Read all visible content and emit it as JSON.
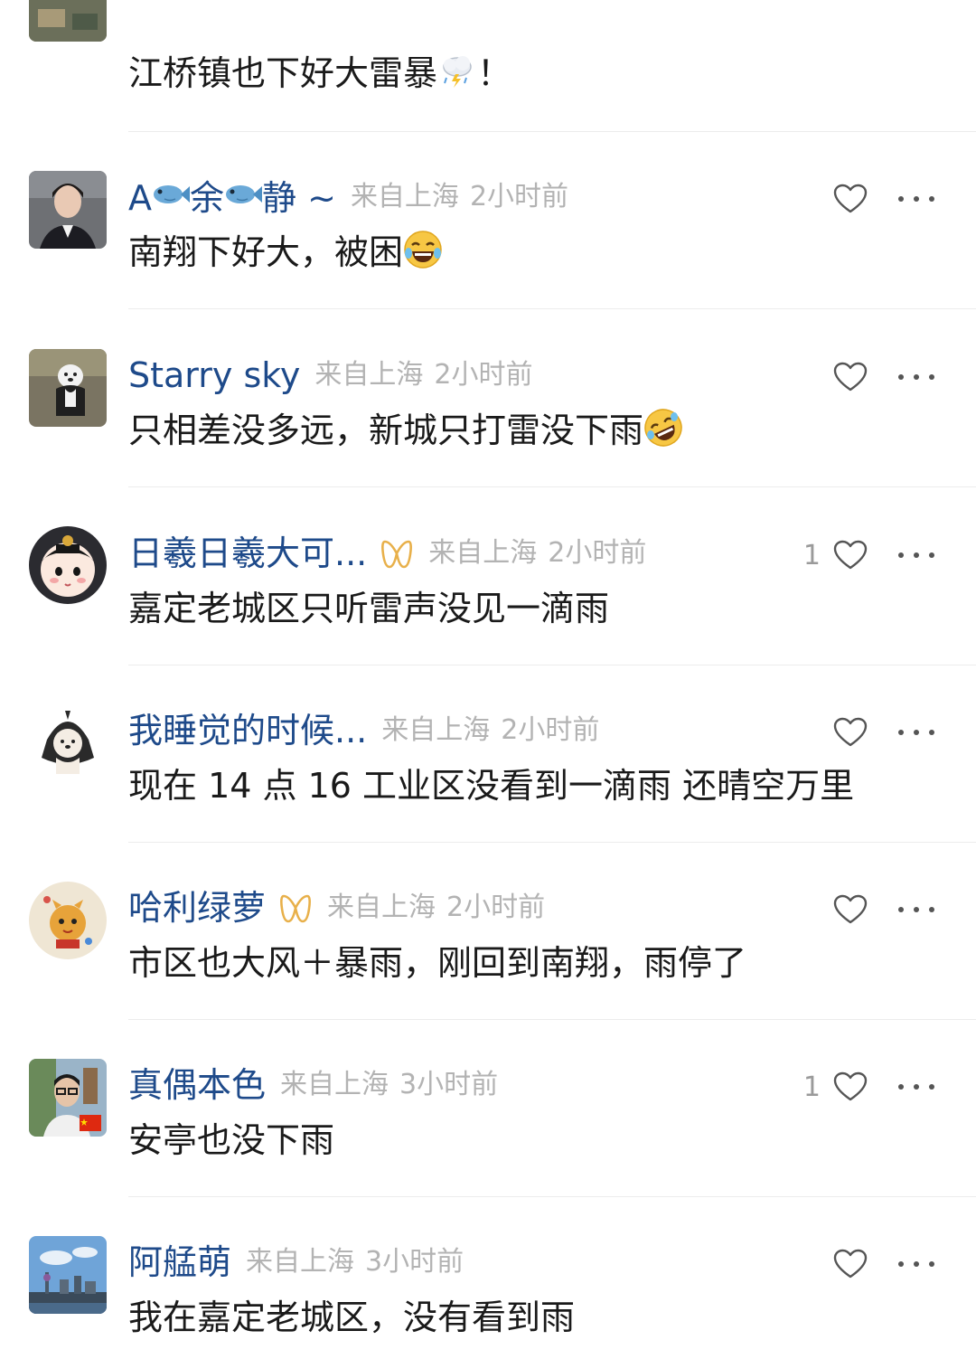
{
  "comments": [
    {
      "username": "",
      "text": "江桥镇也下好大雷暴",
      "text_suffix": "！",
      "emoji": "thunderstorm-emoji"
    },
    {
      "username_parts": [
        "A",
        "余",
        "静 ~"
      ],
      "location": "来自上海",
      "time": "2小时前",
      "text": "南翔下好大，被困",
      "emoji": "laughing-crying-emoji",
      "likes": ""
    },
    {
      "username": "Starry sky",
      "location": "来自上海",
      "time": "2小时前",
      "text": "只相差没多远，新城只打雷没下雨",
      "emoji": "rolling-laughing-emoji",
      "likes": ""
    },
    {
      "username": "日羲日羲大可...",
      "badge": "fan-badge-icon",
      "location": "来自上海",
      "time": "2小时前",
      "text": "嘉定老城区只听雷声没见一滴雨",
      "likes": "1"
    },
    {
      "username": "我睡觉的时候...",
      "location": "来自上海",
      "time": "2小时前",
      "text": "现在 14 点 16 工业区没看到一滴雨 还晴空万里",
      "likes": ""
    },
    {
      "username": "哈利绿萝",
      "badge": "fan-badge-icon",
      "location": "来自上海",
      "time": "2小时前",
      "text": "市区也大风＋暴雨，刚回到南翔，雨停了",
      "likes": ""
    },
    {
      "username": "真偶本色",
      "location": "来自上海",
      "time": "3小时前",
      "text": "安亭也没下雨",
      "likes": "1"
    },
    {
      "username": "阿艋萌",
      "location": "来自上海",
      "time": "3小时前",
      "text": "我在嘉定老城区，没有看到雨",
      "likes": ""
    }
  ],
  "colors": {
    "username": "#1e4a8a",
    "meta": "#b3b3b3",
    "text": "#1a1a1a",
    "divider": "#ececec",
    "badge": "#e8b04a"
  }
}
